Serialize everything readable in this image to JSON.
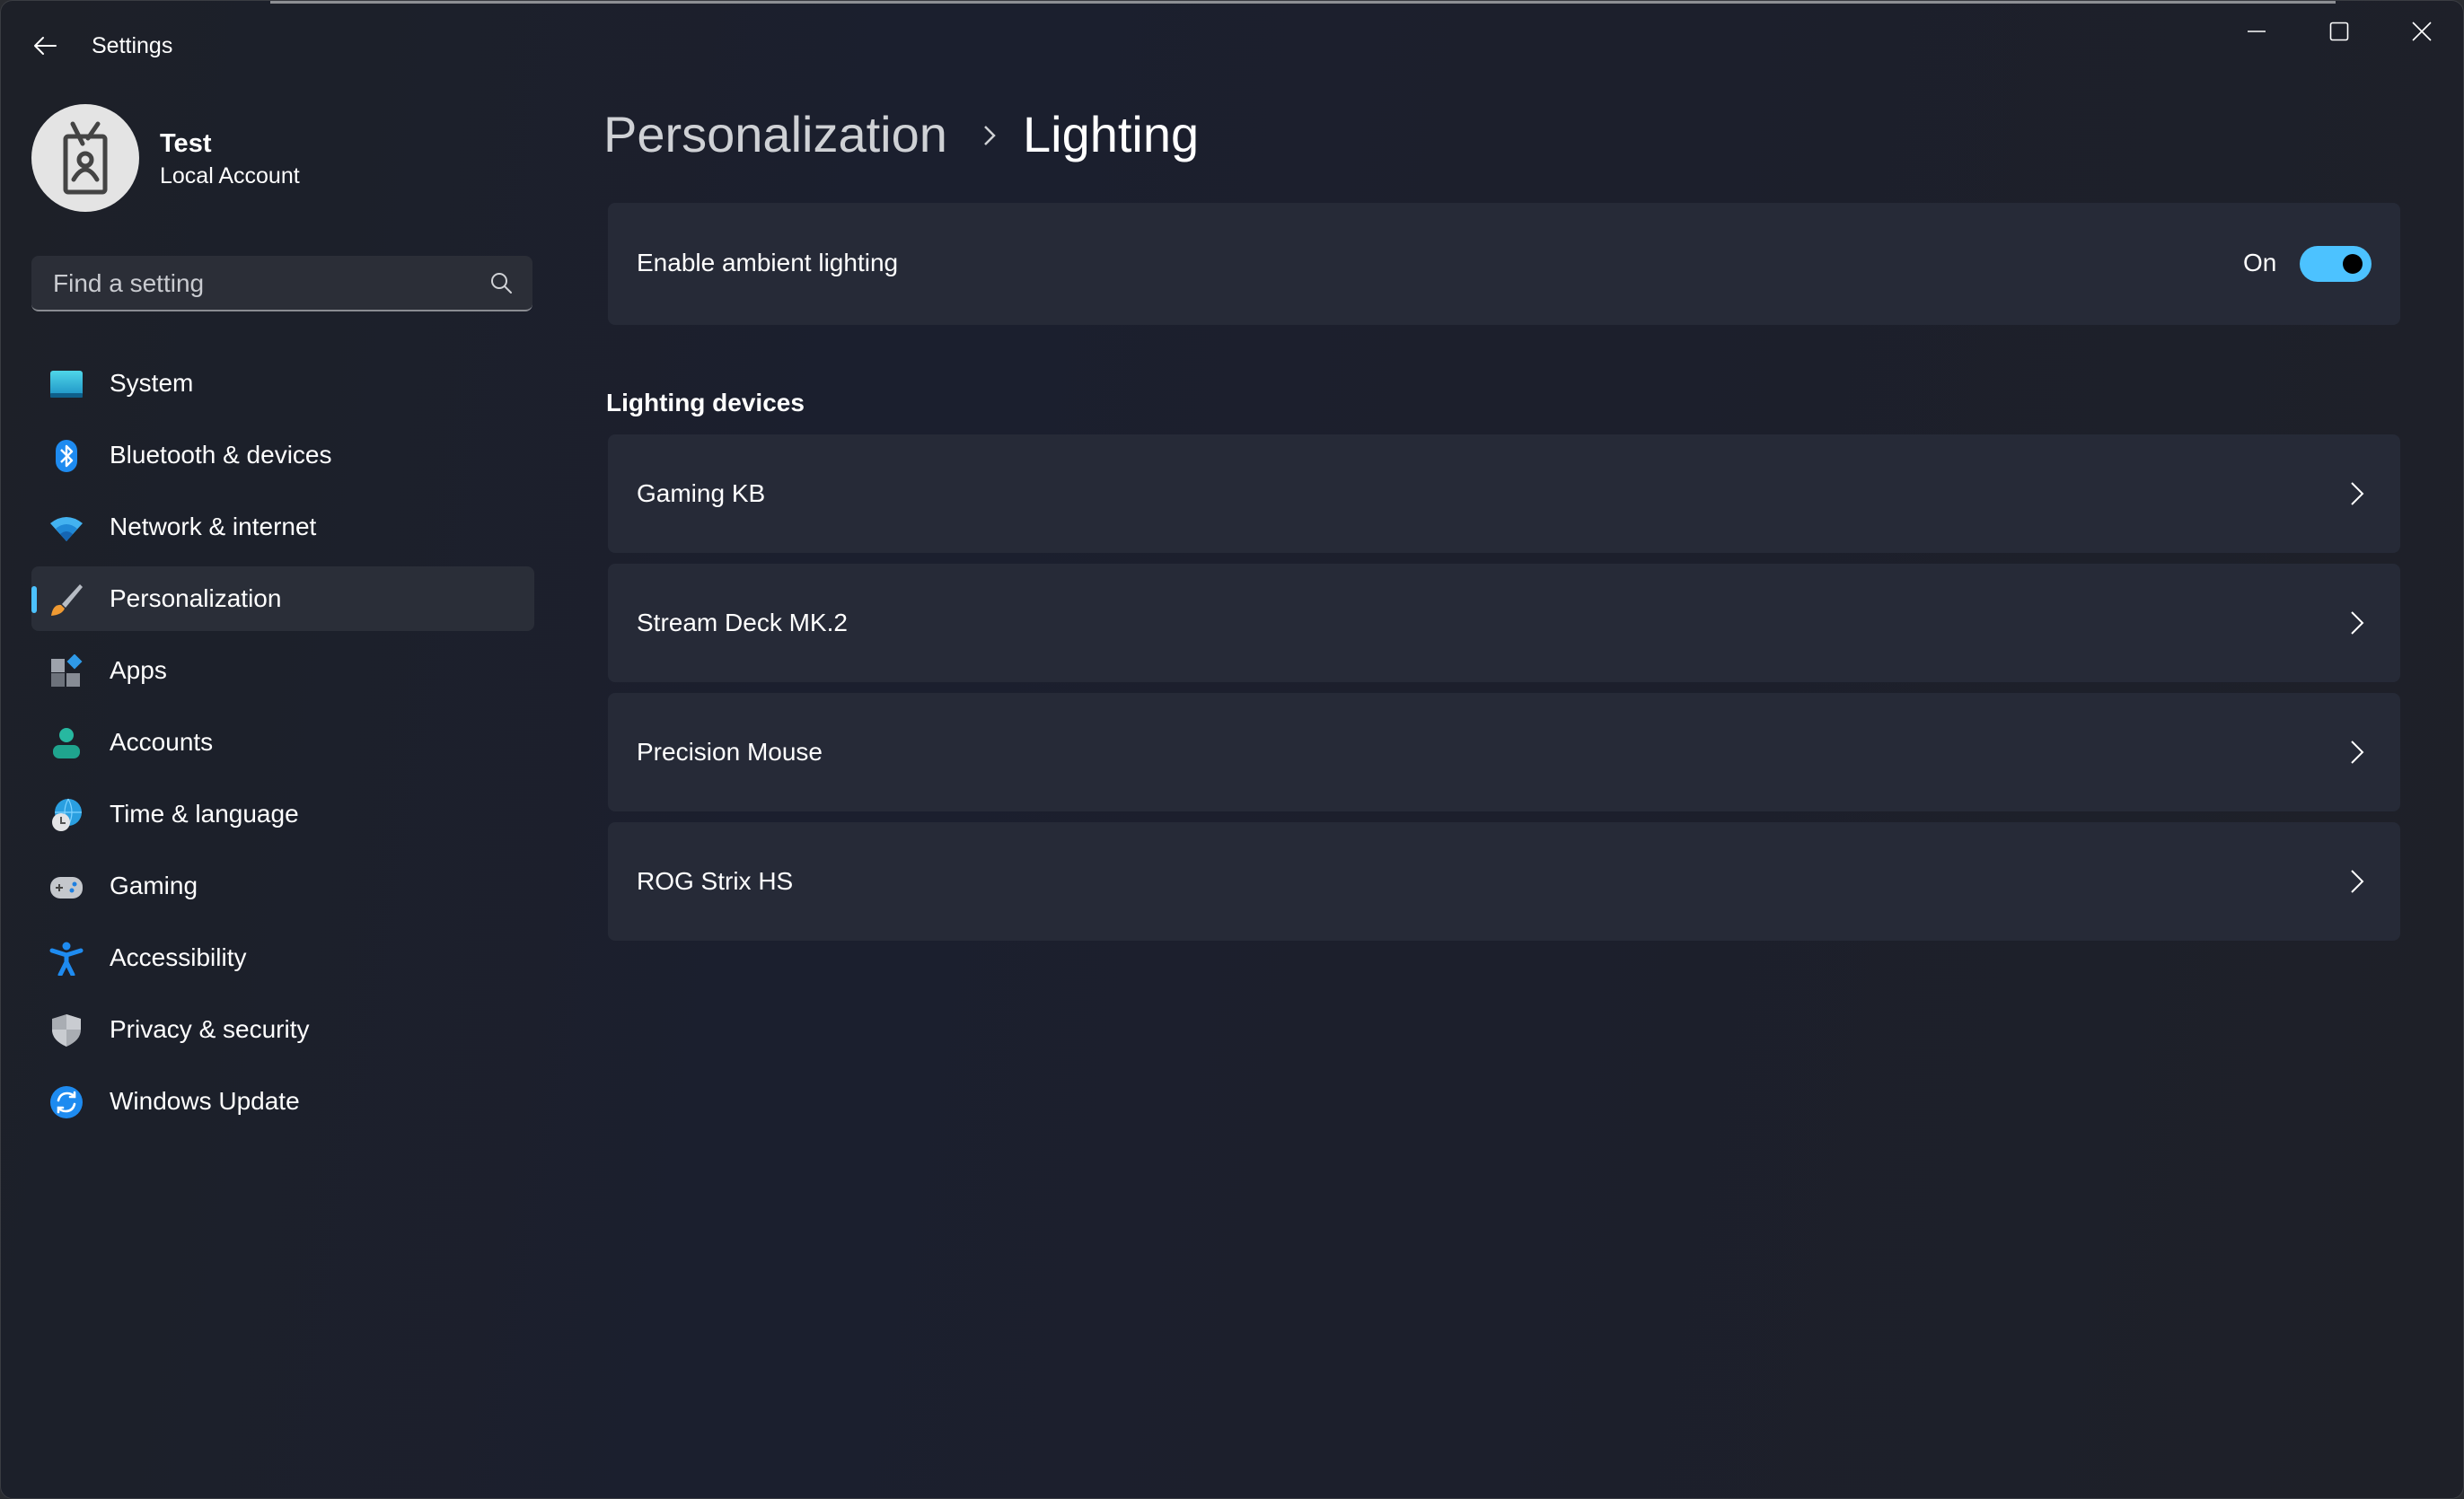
{
  "window": {
    "title": "Settings",
    "controls": {
      "minimize": "minimize-icon",
      "maximize": "maximize-icon",
      "close": "close-icon"
    }
  },
  "profile": {
    "name": "Test",
    "account_type": "Local Account",
    "avatar_icon": "id-badge-icon"
  },
  "search": {
    "placeholder": "Find a setting",
    "value": "",
    "icon": "search-icon"
  },
  "sidebar": {
    "selected": "Personalization",
    "items": [
      {
        "label": "System",
        "icon": "monitor-icon"
      },
      {
        "label": "Bluetooth & devices",
        "icon": "bluetooth-icon"
      },
      {
        "label": "Network & internet",
        "icon": "wifi-icon"
      },
      {
        "label": "Personalization",
        "icon": "paintbrush-icon"
      },
      {
        "label": "Apps",
        "icon": "apps-icon"
      },
      {
        "label": "Accounts",
        "icon": "person-icon"
      },
      {
        "label": "Time & language",
        "icon": "globe-clock-icon"
      },
      {
        "label": "Gaming",
        "icon": "gamepad-icon"
      },
      {
        "label": "Accessibility",
        "icon": "accessibility-icon"
      },
      {
        "label": "Privacy & security",
        "icon": "shield-icon"
      },
      {
        "label": "Windows Update",
        "icon": "sync-icon"
      }
    ]
  },
  "breadcrumb": {
    "parent": "Personalization",
    "current": "Lighting"
  },
  "ambient_lighting": {
    "label": "Enable ambient lighting",
    "state_label": "On",
    "enabled": true
  },
  "lighting_devices": {
    "title": "Lighting devices",
    "items": [
      {
        "name": "Gaming KB"
      },
      {
        "name": "Stream Deck MK.2"
      },
      {
        "name": "Precision Mouse"
      },
      {
        "name": "ROG Strix HS"
      }
    ]
  },
  "colors": {
    "accent": "#4cc2ff",
    "card": "#262a37",
    "background": "#1c1f2c"
  }
}
